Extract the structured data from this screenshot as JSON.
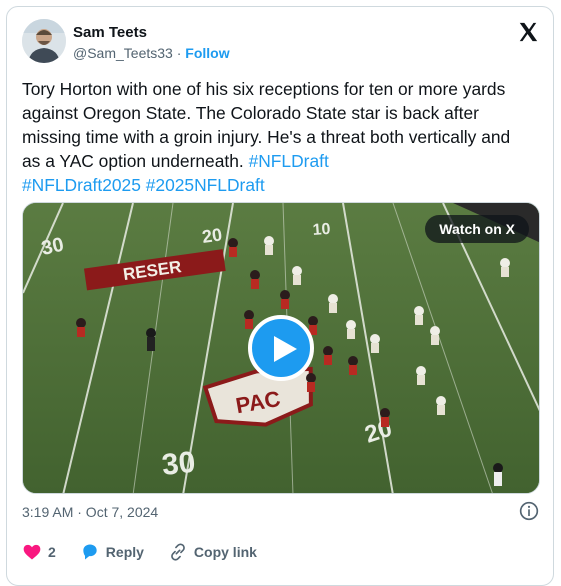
{
  "author": {
    "name": "Sam Teets",
    "handle": "@Sam_Teets33",
    "separator": "·",
    "follow_label": "Follow"
  },
  "tweet": {
    "text": "Tory Horton with one of his six receptions for ten or more yards against Oregon State. The Colorado State star is back after missing time with a groin injury. He's a threat both vertically and as a YAC option underneath. ",
    "hashtags": [
      "#NFLDraft",
      "#NFLDraft2025",
      "#2025NFLDraft"
    ]
  },
  "media": {
    "watch_label": "Watch on X",
    "field_numbers": [
      "30",
      "20",
      "10",
      "30",
      "20"
    ],
    "banner_text": "RESER"
  },
  "timestamp": "3:19 AM · Oct 7, 2024",
  "actions": {
    "like_count": "2",
    "reply_label": "Reply",
    "copy_link_label": "Copy link"
  },
  "colors": {
    "accent": "#1d9bf0",
    "like": "#f91880",
    "text": "#0f1419",
    "muted": "#536471",
    "turf": "#4a6b34"
  },
  "icons": [
    "x-logo-icon",
    "play-icon",
    "info-icon",
    "heart-icon",
    "reply-icon",
    "link-icon"
  ]
}
